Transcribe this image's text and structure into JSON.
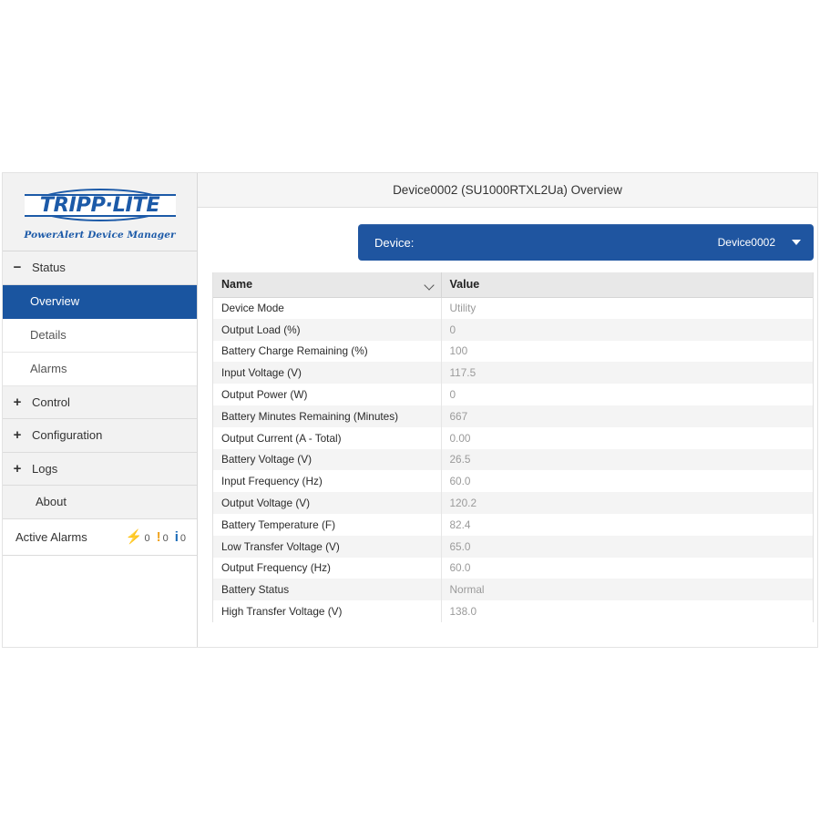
{
  "sidebar": {
    "logo": {
      "brand": "TRIPP·LITE",
      "subtitle": "PowerAlert Device Manager"
    },
    "groups": [
      {
        "expander": "−",
        "label": "Status"
      },
      {
        "expander": "+",
        "label": "Control"
      },
      {
        "expander": "+",
        "label": "Configuration"
      },
      {
        "expander": "+",
        "label": "Logs"
      },
      {
        "expander": "",
        "label": "About"
      }
    ],
    "status_items": [
      {
        "label": "Overview",
        "active": true
      },
      {
        "label": "Details",
        "active": false
      },
      {
        "label": "Alarms",
        "active": false
      }
    ],
    "alarms": {
      "label": "Active Alarms",
      "counters": [
        {
          "icon": "critical-alarm-icon",
          "glyph": "⚡",
          "count": "0",
          "color": "#d63f16"
        },
        {
          "icon": "warning-alarm-icon",
          "glyph": "!",
          "count": "0",
          "color": "#f0a31e"
        },
        {
          "icon": "info-alarm-icon",
          "glyph": "i",
          "count": "0",
          "color": "#1a6bb8"
        }
      ]
    }
  },
  "main": {
    "title": "Device0002 (SU1000RTXL2Ua) Overview",
    "device_select": {
      "label": "Device:",
      "value": "Device0002",
      "caret": "chevron-down-icon"
    },
    "table": {
      "columns": [
        "Name",
        "Value"
      ],
      "rows": [
        {
          "name": "Device Mode",
          "value": "Utility"
        },
        {
          "name": "Output Load (%)",
          "value": "0"
        },
        {
          "name": "Battery Charge Remaining (%)",
          "value": "100"
        },
        {
          "name": "Input Voltage (V)",
          "value": "117.5"
        },
        {
          "name": "Output Power (W)",
          "value": "0"
        },
        {
          "name": "Battery Minutes Remaining (Minutes)",
          "value": "667"
        },
        {
          "name": "Output Current (A - Total)",
          "value": "0.00"
        },
        {
          "name": "Battery Voltage (V)",
          "value": "26.5"
        },
        {
          "name": "Input Frequency (Hz)",
          "value": "60.0"
        },
        {
          "name": "Output Voltage (V)",
          "value": "120.2"
        },
        {
          "name": "Battery Temperature (F)",
          "value": "82.4"
        },
        {
          "name": "Low Transfer Voltage (V)",
          "value": "65.0"
        },
        {
          "name": "Output Frequency (Hz)",
          "value": "60.0"
        },
        {
          "name": "Battery Status",
          "value": "Normal"
        },
        {
          "name": "High Transfer Voltage (V)",
          "value": "138.0"
        }
      ]
    }
  },
  "colors": {
    "brand_blue": "#1c5aa8",
    "accent_blue": "#1f55a0",
    "active_nav": "#1a55a0",
    "row_alt": "#f4f4f4",
    "header_gray": "#e8e8e8"
  }
}
